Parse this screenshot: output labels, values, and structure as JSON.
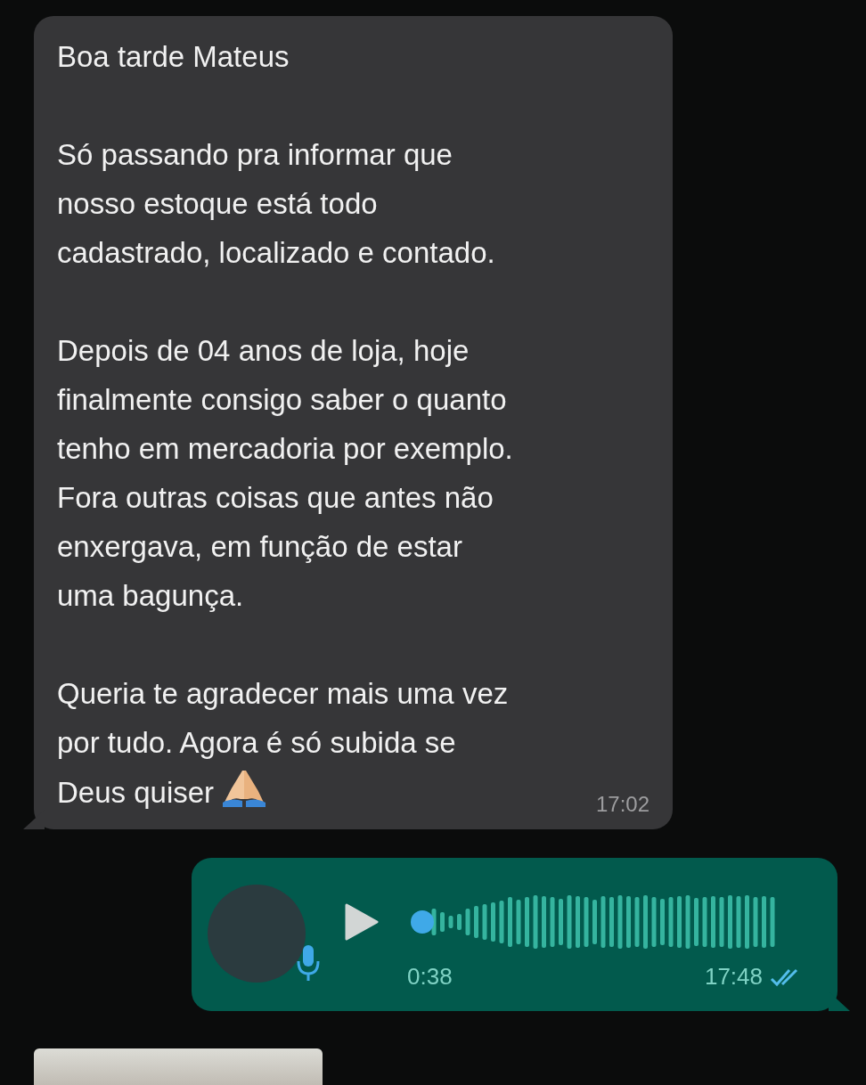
{
  "messages": [
    {
      "kind": "text",
      "paragraphs": [
        "Boa tarde Mateus",
        "Só passando pra informar que\nnosso estoque está todo\ncadastrado, localizado e contado.",
        "Depois de 04 anos de loja, hoje\nfinalmente consigo saber o quanto\ntenho em mercadoria por exemplo.\nFora outras coisas que antes não\nenxergava, em função de estar\numa bagunça.",
        "Queria te agradecer mais uma vez\npor tudo. Agora é só subida se\nDeus quiser"
      ],
      "time": "17:02"
    },
    {
      "kind": "voice",
      "duration": "0:38",
      "time": "17:48",
      "level": 0,
      "read": true
    },
    {
      "kind": "photo"
    }
  ]
}
